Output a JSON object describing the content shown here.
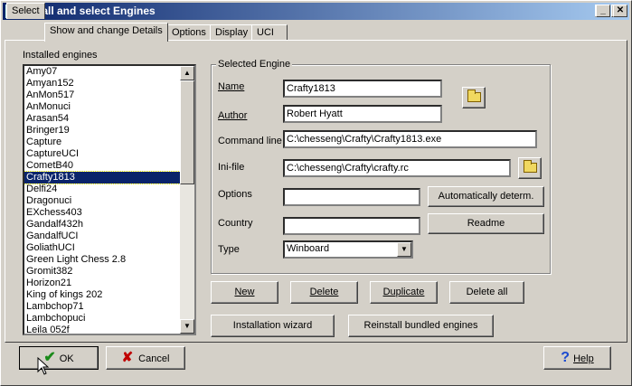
{
  "window": {
    "title": "Install and select Engines"
  },
  "tabs": [
    {
      "label": "Select"
    },
    {
      "label": "Show and change Details"
    },
    {
      "label": "Options"
    },
    {
      "label": "Display"
    },
    {
      "label": "UCI"
    }
  ],
  "installed_engines": {
    "label": "Installed engines",
    "items": [
      "Amy07",
      "Amyan152",
      "AnMon517",
      "AnMonuci",
      "Arasan54",
      "Bringer19",
      "Capture",
      "CaptureUCI",
      "CometB40",
      "Crafty1813",
      "Delfi24",
      "Dragonuci",
      "EXchess403",
      "Gandalf432h",
      "GandalfUCI",
      "GoliathUCI",
      "Green Light Chess 2.8",
      "Gromit382",
      "Horizon21",
      "King of kings 202",
      "Lambchop71",
      "Lambchopuci",
      "Leila 052f"
    ],
    "selected": "Crafty1813"
  },
  "selected_engine": {
    "title": "Selected Engine",
    "name_label": "Name",
    "name_value": "Crafty1813",
    "author_label": "Author",
    "author_value": "Robert Hyatt",
    "command_label": "Command line",
    "command_value": "C:\\chesseng\\Crafty\\Crafty1813.exe",
    "ini_label": "Ini-file",
    "ini_value": "C:\\chesseng\\Crafty\\crafty.rc",
    "options_label": "Options",
    "options_value": "",
    "auto_determ_label": "Automatically determ.",
    "country_label": "Country",
    "country_value": "",
    "readme_label": "Readme",
    "type_label": "Type",
    "type_value": "Winboard"
  },
  "actions": {
    "new": "New",
    "delete": "Delete",
    "duplicate": "Duplicate",
    "delete_all": "Delete all",
    "installation_wizard": "Installation wizard",
    "reinstall": "Reinstall bundled engines"
  },
  "footer": {
    "ok": "OK",
    "cancel": "Cancel",
    "help": "Help"
  }
}
